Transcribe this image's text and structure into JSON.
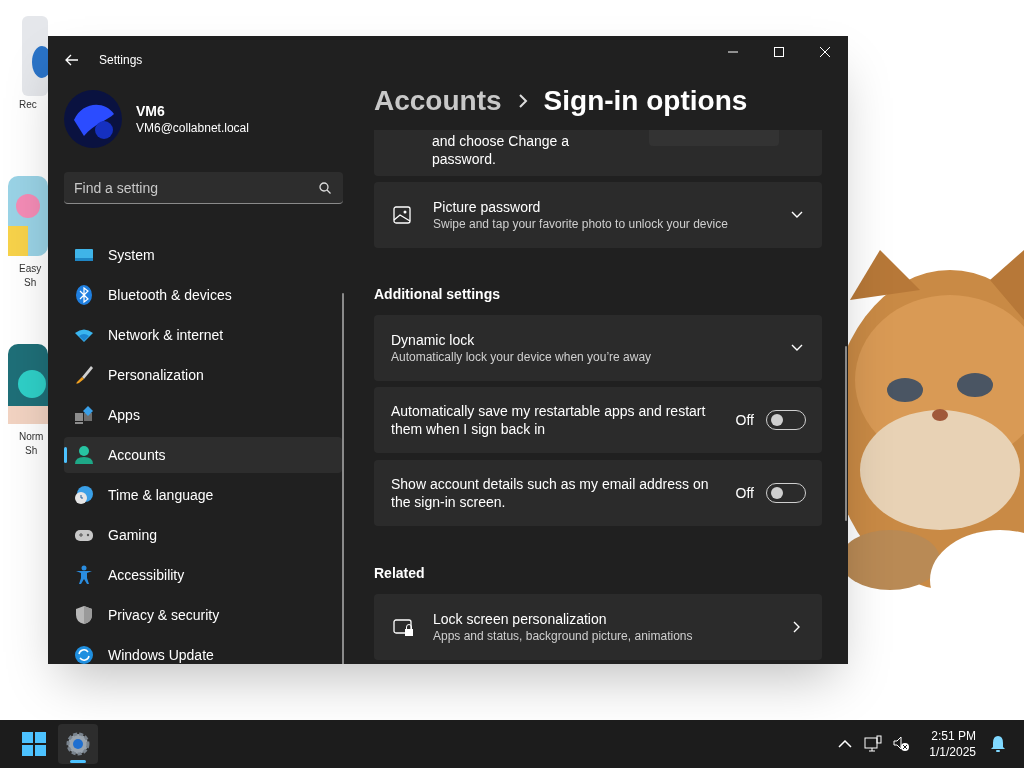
{
  "desktop_icons": [
    {
      "lines": [
        "Rec"
      ]
    },
    {
      "lines": [
        "Easy",
        "Sh"
      ]
    },
    {
      "lines": [
        "Norm",
        "Sh"
      ]
    }
  ],
  "window": {
    "title": "Settings"
  },
  "user": {
    "name": "VM6",
    "email": "VM6@collabnet.local"
  },
  "search": {
    "placeholder": "Find a setting"
  },
  "nav": [
    {
      "label": "System",
      "selected": false
    },
    {
      "label": "Bluetooth & devices",
      "selected": false
    },
    {
      "label": "Network & internet",
      "selected": false
    },
    {
      "label": "Personalization",
      "selected": false
    },
    {
      "label": "Apps",
      "selected": false
    },
    {
      "label": "Accounts",
      "selected": true
    },
    {
      "label": "Time & language",
      "selected": false
    },
    {
      "label": "Gaming",
      "selected": false
    },
    {
      "label": "Accessibility",
      "selected": false
    },
    {
      "label": "Privacy & security",
      "selected": false
    },
    {
      "label": "Windows Update",
      "selected": false
    }
  ],
  "breadcrumb": [
    "Accounts",
    "Sign-in options"
  ],
  "content": [
    {
      "kind": "partial",
      "text": "and choose Change a password."
    },
    {
      "kind": "expander",
      "title": "Picture password",
      "subtitle": "Swipe and tap your favorite photo to unlock your device"
    },
    {
      "kind": "heading",
      "text": "Additional settings"
    },
    {
      "kind": "expander",
      "title": "Dynamic lock",
      "subtitle": "Automatically lock your device when you’re away"
    },
    {
      "kind": "toggle",
      "text": "Automatically save my restartable apps and restart them when I sign back in",
      "state_label": "Off",
      "on": false
    },
    {
      "kind": "toggle",
      "text": "Show account details such as my email address on the sign-in screen.",
      "state_label": "Off",
      "on": false
    },
    {
      "kind": "heading",
      "text": "Related"
    },
    {
      "kind": "link",
      "title": "Lock screen personalization",
      "subtitle": "Apps and status, background picture, animations"
    }
  ],
  "taskbar": {
    "time": "2:51 PM",
    "date": "1/1/2025"
  }
}
